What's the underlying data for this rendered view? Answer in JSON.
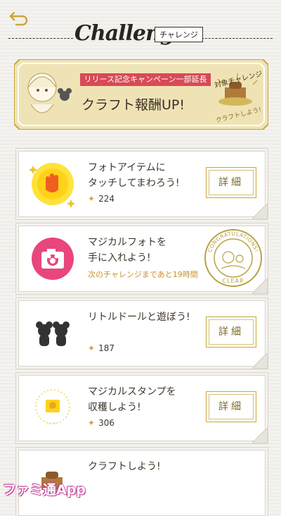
{
  "header": {
    "title": "Challenge",
    "badge": "チャレンジ"
  },
  "banner": {
    "red_label": "リリース記念キャンペーン一部延長",
    "main_text": "クラフト報酬UP!",
    "target_label": "対象チャレンジ",
    "craft_label": "クラフトしよう!"
  },
  "challenges": [
    {
      "line1": "フォトアイテムに",
      "line2": "タッチしてまわろう!",
      "points": "224",
      "button": "詳細",
      "icon": "glove-touch-icon"
    },
    {
      "line1": "マジカルフォトを",
      "line2": "手に入れよう!",
      "note": "次のチャレンジまであと19時間",
      "stamp": "congratulations-clear-stamp",
      "stamp_top": "CONGRATULATIONS!",
      "stamp_bottom": "CLEAR",
      "icon": "camera-icon"
    },
    {
      "line1": "リトルドールと遊ぼう!",
      "points": "187",
      "button": "詳細",
      "icon": "mouse-silhouette-icon"
    },
    {
      "line1": "マジカルスタンプを",
      "line2": "収穫しよう!",
      "points": "306",
      "button": "詳細",
      "icon": "stamp-icon"
    },
    {
      "line1": "クラフトしよう!",
      "icon": "craft-icon"
    }
  ],
  "watermark": "ファミ通App",
  "colors": {
    "accent_red": "#d84a56",
    "gold": "#c9a73a",
    "pink": "#e8467c"
  }
}
